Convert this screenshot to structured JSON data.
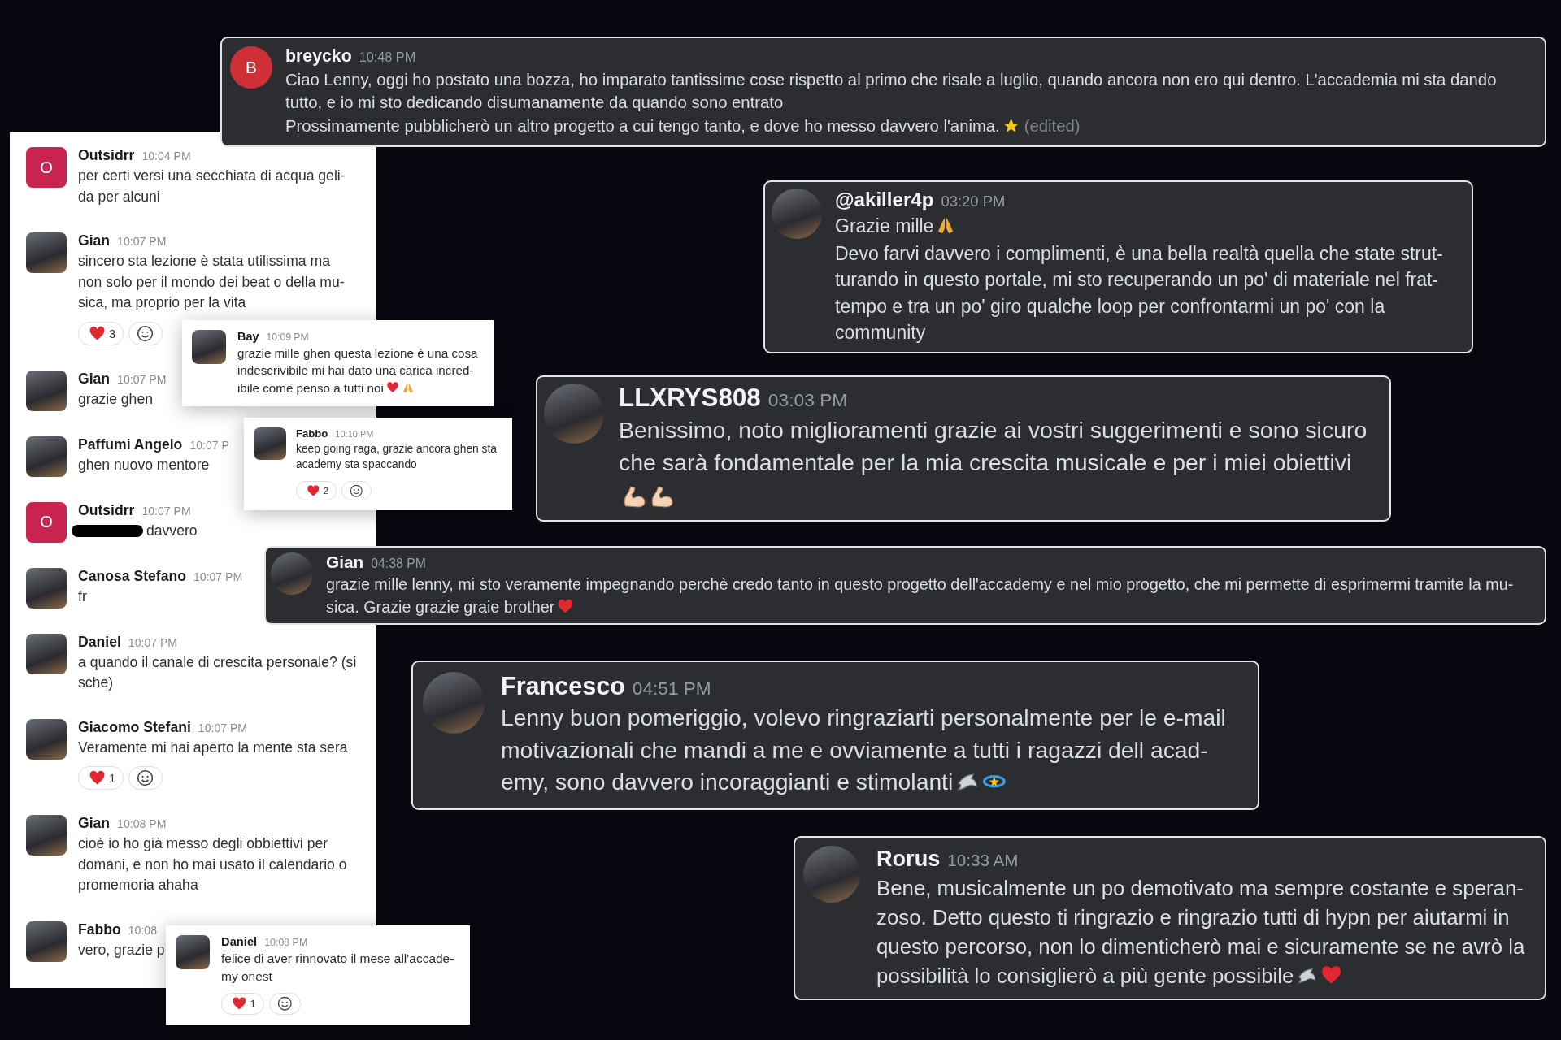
{
  "side_panel": {
    "messages": [
      {
        "author": "Outsidrr",
        "time": "10:04 PM",
        "avatar": {
          "kind": "letter",
          "letter": "O",
          "color": "#c9234f"
        },
        "lines": [
          "per certi versi una secchiata di acqua geli-",
          "da per alcuni"
        ]
      },
      {
        "author": "Gian",
        "time": "10:07 PM",
        "avatar": {
          "kind": "photo"
        },
        "lines": [
          "sincero sta lezione è stata utilissima ma",
          "non solo per il mondo dei beat o della mu-",
          "sica, ma proprio per la vita"
        ],
        "reactions": [
          {
            "kind": "heart",
            "count": "3"
          }
        ]
      },
      {
        "author": "Gian",
        "time": "10:07 PM",
        "avatar": {
          "kind": "photo"
        },
        "lines": [
          "grazie ghen"
        ]
      },
      {
        "author": "Paffumi Angelo",
        "time": "10:07 P",
        "avatar": {
          "kind": "photo"
        },
        "lines": [
          "ghen nuovo mentore"
        ]
      },
      {
        "author": "Outsidrr",
        "time": "10:07 PM",
        "avatar": {
          "kind": "letter",
          "letter": "O",
          "color": "#c9234f"
        },
        "redacted": true,
        "lines": [
          "davvero"
        ]
      },
      {
        "author": "Canosa Stefano",
        "time": "10:07 PM",
        "avatar": {
          "kind": "photo"
        },
        "lines": [
          "fr"
        ]
      },
      {
        "author": "Daniel",
        "time": "10:07 PM",
        "avatar": {
          "kind": "photo"
        },
        "lines": [
          "a quando il canale di crescita personale? (si",
          "sche)"
        ]
      },
      {
        "author": "Giacomo Stefani",
        "time": "10:07 PM",
        "avatar": {
          "kind": "photo"
        },
        "lines": [
          "Veramente mi hai aperto la mente sta sera"
        ],
        "reactions": [
          {
            "kind": "heart",
            "count": "1"
          }
        ]
      },
      {
        "author": "Gian",
        "time": "10:08 PM",
        "avatar": {
          "kind": "photo"
        },
        "lines": [
          "cioè io ho già messo degli obbiettivi per",
          "domani, e non ho mai usato il calendario o",
          "promemoria ahaha"
        ]
      },
      {
        "author": "Fabbo",
        "time": "10:08",
        "avatar": {
          "kind": "photo"
        },
        "lines": [
          "vero, grazie p"
        ]
      }
    ]
  },
  "cards": [
    {
      "kind": "dark",
      "author": "breycko",
      "time": "10:48 PM",
      "avatar": {
        "kind": "letter",
        "letter": "B",
        "color": "#cf2f36"
      },
      "lines": [
        "Ciao Lenny, oggi ho postato una bozza, ho imparato tantissime cose rispetto al primo che risale a luglio, quando ancora non ero qui dentro. L'accademia mi sta dando",
        "tutto, e io mi sto dedicando disumanamente da quando sono entrato",
        "Prossimamente pubblicherò un altro progetto a cui tengo tanto, e dove ho messo davvero l'anima."
      ],
      "emojis": [
        {
          "kind": "star"
        }
      ],
      "edited": "(edited)"
    },
    {
      "kind": "dark",
      "author": "@akiller4p",
      "time": "03:20 PM",
      "avatar": {
        "kind": "photo"
      },
      "lines": [
        "Grazie mille"
      ],
      "emojis": [
        {
          "kind": "pray"
        }
      ],
      "more_lines": [
        "Devo farvi davvero i complimenti, è una bella realtà quella che state strut-",
        "turando in questo portale, mi sto recuperando un po' di materiale nel frat-",
        "tempo e tra un po' giro qualche loop per confrontarmi un po' con la",
        "community"
      ]
    },
    {
      "kind": "light",
      "author": "Bay",
      "time": "10:09 PM",
      "avatar": {
        "kind": "photo"
      },
      "lines": [
        "grazie mille ghen questa lezione è una cosa",
        "indescrivibile mi hai dato una carica incred-",
        "ibile come penso a tutti noi"
      ],
      "emojis": [
        {
          "kind": "heart"
        },
        {
          "kind": "pray"
        }
      ]
    },
    {
      "kind": "dark",
      "author": "LLXRYS808",
      "time": "03:03 PM",
      "avatar": {
        "kind": "photo"
      },
      "lines": [
        "Benissimo, noto miglioramenti grazie ai vostri suggerimenti e sono sicuro",
        "che sarà fondamentale per la mia crescita musicale e per i miei obiettivi"
      ],
      "emoji_line": [
        {
          "kind": "arm"
        },
        {
          "kind": "arm"
        }
      ]
    },
    {
      "kind": "light",
      "author": "Fabbo",
      "time": "10:10 PM",
      "avatar": {
        "kind": "photo"
      },
      "lines": [
        "keep going raga, grazie ancora ghen sta",
        "academy sta spaccando"
      ],
      "reactions": [
        {
          "kind": "heart",
          "count": "2"
        }
      ]
    },
    {
      "kind": "dark",
      "author": "Gian",
      "time": "04:38 PM",
      "avatar": {
        "kind": "photo"
      },
      "lines": [
        "grazie mille lenny, mi sto veramente impegnando perchè credo tanto in questo progetto dell'accademy e nel mio progetto, che mi permette di esprimermi tramite la mu-",
        "sica. Grazie grazie graie brother"
      ],
      "emojis": [
        {
          "kind": "heart"
        }
      ]
    },
    {
      "kind": "dark",
      "author": "Francesco",
      "time": "04:51 PM",
      "avatar": {
        "kind": "photo"
      },
      "lines": [
        "Lenny buon pomeriggio, volevo ringraziarti personalmente per le e-mail",
        "motivazionali che mandi a me e ovviamente a tutti i ragazzi dell acad-",
        "emy, sono davvero incoraggianti e stimolanti"
      ],
      "emojis": [
        {
          "kind": "shark"
        },
        {
          "kind": "orbit"
        }
      ]
    },
    {
      "kind": "dark",
      "author": "Rorus",
      "time": "10:33 AM",
      "avatar": {
        "kind": "photo"
      },
      "lines": [
        "Bene, musicalmente un po demotivato ma sempre costante e speran-",
        "zoso. Detto questo ti ringrazio e ringrazio tutti di hypn per aiutarmi in",
        "questo percorso, non lo dimenticherò mai e sicuramente se ne avrò la",
        "possibilità lo consiglierò a più gente possibile"
      ],
      "emojis": [
        {
          "kind": "shark"
        },
        {
          "kind": "heart"
        }
      ]
    },
    {
      "kind": "light",
      "author": "Daniel",
      "time": "10:08 PM",
      "avatar": {
        "kind": "photo"
      },
      "lines": [
        "felice di aver rinnovato il mese all'accade-",
        "my onest"
      ],
      "reactions": [
        {
          "kind": "heart",
          "count": "1"
        }
      ]
    }
  ]
}
